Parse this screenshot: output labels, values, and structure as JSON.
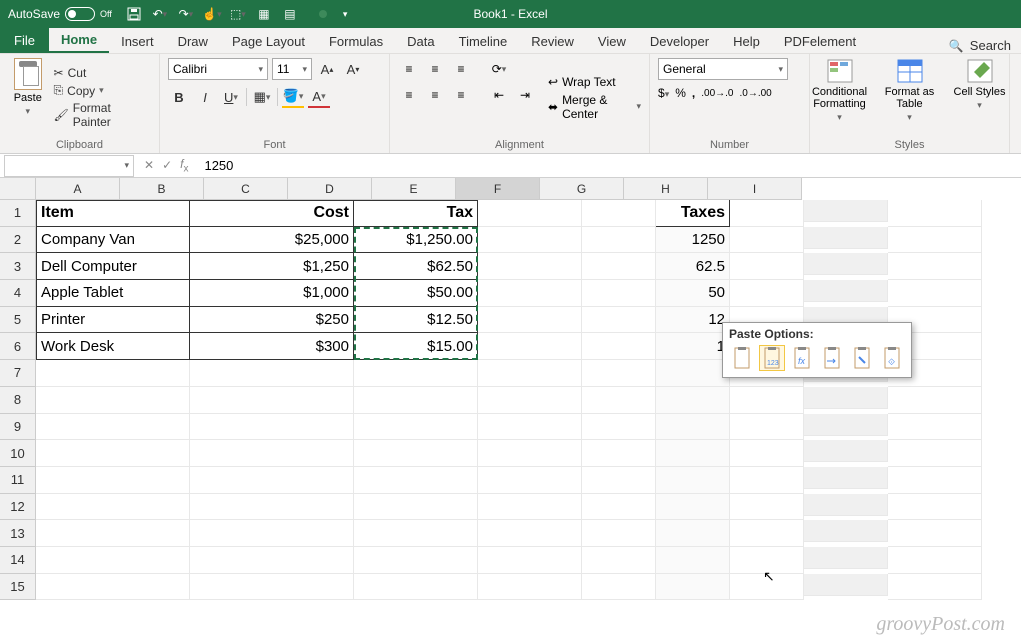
{
  "titlebar": {
    "autosave": "AutoSave",
    "autosave_state": "Off",
    "doc_title": "Book1 - Excel"
  },
  "tabs": {
    "file": "File",
    "home": "Home",
    "insert": "Insert",
    "draw": "Draw",
    "pagelayout": "Page Layout",
    "formulas": "Formulas",
    "data": "Data",
    "timeline": "Timeline",
    "review": "Review",
    "view": "View",
    "developer": "Developer",
    "help": "Help",
    "pdfelement": "PDFelement",
    "search": "Search"
  },
  "ribbon": {
    "clipboard": {
      "label": "Clipboard",
      "paste": "Paste",
      "cut": "Cut",
      "copy": "Copy",
      "format_painter": "Format Painter"
    },
    "font": {
      "label": "Font",
      "name": "Calibri",
      "size": "11"
    },
    "alignment": {
      "label": "Alignment",
      "wrap": "Wrap Text",
      "merge": "Merge & Center"
    },
    "number": {
      "label": "Number",
      "format": "General"
    },
    "styles": {
      "label": "Styles",
      "cond": "Conditional Formatting",
      "table": "Format as Table",
      "cell": "Cell Styles"
    }
  },
  "formula_bar": {
    "name_box": "",
    "formula": "1250"
  },
  "columns": [
    "A",
    "B",
    "C",
    "D",
    "E",
    "F",
    "G",
    "H",
    "I"
  ],
  "rows_shown": 15,
  "data_rows": [
    {
      "r": 1,
      "A": "Item",
      "B": "Cost",
      "C": "Tax",
      "F": "Taxes"
    },
    {
      "r": 2,
      "A": "Company Van",
      "B": "$25,000",
      "C": "$1,250.00",
      "F": "1250"
    },
    {
      "r": 3,
      "A": "Dell Computer",
      "B": "$1,250",
      "C": "$62.50",
      "F": "62.5"
    },
    {
      "r": 4,
      "A": "Apple Tablet",
      "B": "$1,000",
      "C": "$50.00",
      "F": "50"
    },
    {
      "r": 5,
      "A": "Printer",
      "B": "$250",
      "C": "$12.50",
      "F": "12"
    },
    {
      "r": 6,
      "A": "Work Desk",
      "B": "$300",
      "C": "$15.00",
      "F": "1"
    }
  ],
  "pasteopts": {
    "title": "Paste Options:"
  },
  "watermark": "groovyPost.com"
}
